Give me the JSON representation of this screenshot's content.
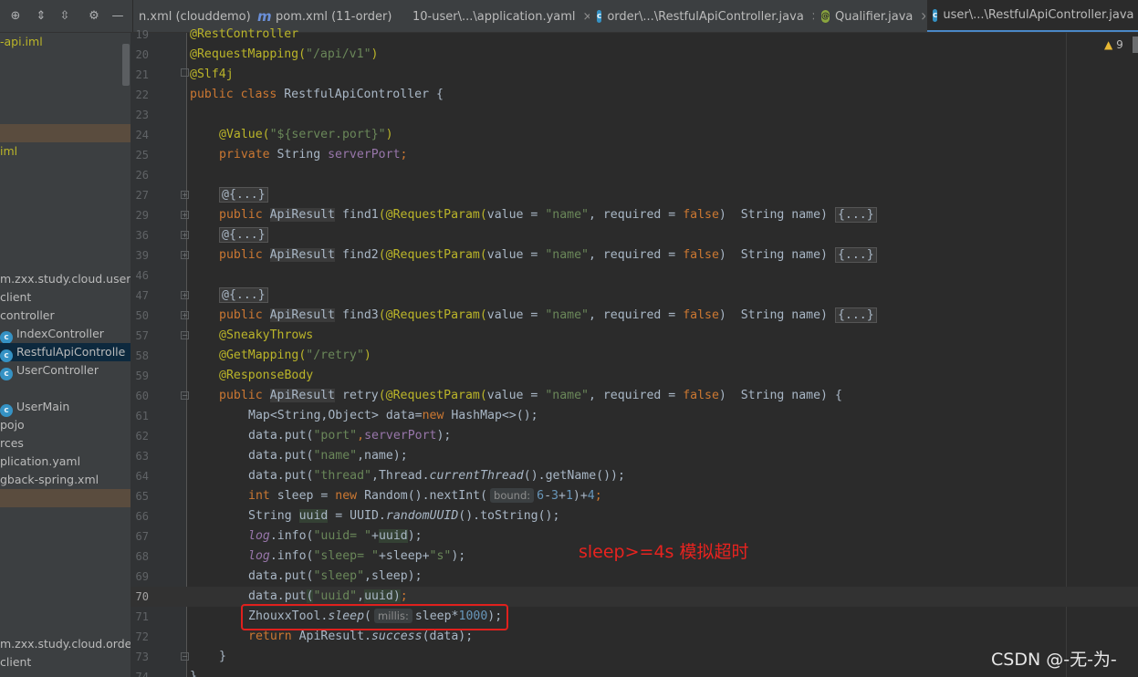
{
  "tabs": [
    {
      "label": "n.xml (clouddemo)",
      "icon": "maven-icon"
    },
    {
      "label": "pom.xml (11-order)",
      "icon": "maven-icon"
    },
    {
      "label": "10-user\\...\\application.yaml",
      "icon": "spring-icon"
    },
    {
      "label": "order\\...\\RestfulApiController.java",
      "icon": "class-icon"
    },
    {
      "label": "Qualifier.java",
      "icon": "annotation-icon"
    },
    {
      "label": "user\\...\\RestfulApiController.java",
      "icon": "class-icon",
      "active": true
    }
  ],
  "sidebar": {
    "items": [
      {
        "label": "-api.iml",
        "style": "yellow"
      },
      {
        "label": "iml",
        "style": "yellow"
      },
      {
        "label": "m.zxx.study.cloud.user"
      },
      {
        "label": "client"
      },
      {
        "label": "controller"
      },
      {
        "label": "IndexController",
        "icon": "class-icon"
      },
      {
        "label": "RestfulApiControlle",
        "icon": "class-icon",
        "selected": true
      },
      {
        "label": "UserController",
        "icon": "class-icon"
      },
      {
        "label": "UserMain",
        "icon": "class-icon"
      },
      {
        "label": "pojo"
      },
      {
        "label": "rces"
      },
      {
        "label": "plication.yaml"
      },
      {
        "label": "gback-spring.xml"
      },
      {
        "label": "m.zxx.study.cloud.orde"
      },
      {
        "label": "client"
      }
    ]
  },
  "gutter": {
    "line_numbers": [
      "19",
      "20",
      "21",
      "22",
      "23",
      "24",
      "25",
      "26",
      "27",
      "29",
      "36",
      "39",
      "46",
      "47",
      "50",
      "57",
      "58",
      "59",
      "60",
      "61",
      "62",
      "63",
      "64",
      "65",
      "66",
      "67",
      "68",
      "69",
      "70",
      "71",
      "72",
      "73",
      "74"
    ],
    "current_line": "70"
  },
  "code": {
    "l19": "@RestController",
    "l20a": "@RequestMapping(",
    "l20b": "\"/api/v1\"",
    "l20c": ")",
    "l21": "@Slf4j",
    "l22a": "public class ",
    "l22b": "RestfulApiController {",
    "l24a": "@Value(",
    "l24b": "\"${server.port}\"",
    "l24c": ")",
    "l25a": "private ",
    "l25b": "String ",
    "l25c": "serverPort",
    "l25d": ";",
    "fold_anno": "@{...}",
    "public": "public ",
    "type": "ApiResult",
    "find1": "find1",
    "find2": "find2",
    "find3": "find3",
    "retry": "retry",
    "reqparam": "(@RequestParam(",
    "value_eq": "value = ",
    "name_str": "\"name\"",
    "comma_req": ", required = ",
    "false": "false",
    "str_name": ")  String name) ",
    "fold_body": "{...}",
    "open_brace": "{",
    "sneaky": "@SneakyThrows",
    "getmap_a": "@GetMapping(",
    "getmap_b": "\"/retry\"",
    "getmap_c": ")",
    "respbody": "@ResponseBody",
    "l61a": "Map<String,Object> data=",
    "l61b": "new ",
    "l61c": "HashMap<>();",
    "dataput": "data.put(",
    "port_str": "\"port\"",
    "name_key": "\"name\"",
    "thread_str": "\"thread\"",
    "sleep_str": "\"sleep\"",
    "uuid_str": "\"uuid\"",
    "l62tail": ");",
    "l63tail": ",name);",
    "l64b": ",Thread.",
    "l64c": "currentThread",
    "l64d": "().getName());",
    "l65a": "int ",
    "l65b": "sleep = ",
    "l65c": "new ",
    "l65d": "Random().nextInt(",
    "hint_bound": "bound:",
    "l65e": "6",
    "l65f": "-",
    "l65g": "3",
    "l65h": "+",
    "l65i": "1",
    "l65j": ")+",
    "l65k": "4",
    "l65l": ";",
    "l66a": "String ",
    "l66b": "uuid",
    "l66c": " = UUID.",
    "l66d": "randomUUID",
    "l66e": "().toString();",
    "log": "log",
    "info": ".info(",
    "uuid_eq": "\"uuid= \"",
    "sleep_eq": "\"sleep= \"",
    "s_str": "\"s\"",
    "plus": "+",
    "uuid": "uuid",
    "l67tail": ");",
    "l68a": "+sleep+",
    "l68b": ");",
    "l69tail": ",sleep);",
    "l70a": "data.put",
    "l70b": "(",
    "l70c": ",",
    "l70d": "uuid",
    "l70e": ")",
    "l70f": ";",
    "l71a": "ZhouxxTool.",
    "l71b": "sleep",
    "l71c": "(",
    "hint_millis": "millis:",
    "l71d": "sleep*",
    "l71e": "1000",
    "l71f": ");",
    "l72a": "return ",
    "l72b": "ApiResult.",
    "l72c": "success",
    "l72d": "(data);",
    "l73": "}",
    "l74": "}"
  },
  "warnings": {
    "count": "9"
  },
  "annotation": "sleep>=4s   模拟超时",
  "watermark": "CSDN @-无-为-",
  "colors": {
    "annotation": "#e8231f",
    "keyword": "#cc7832",
    "annotation_code": "#bbb529",
    "string": "#6a8759",
    "number": "#6897bb",
    "field": "#9876aa"
  }
}
